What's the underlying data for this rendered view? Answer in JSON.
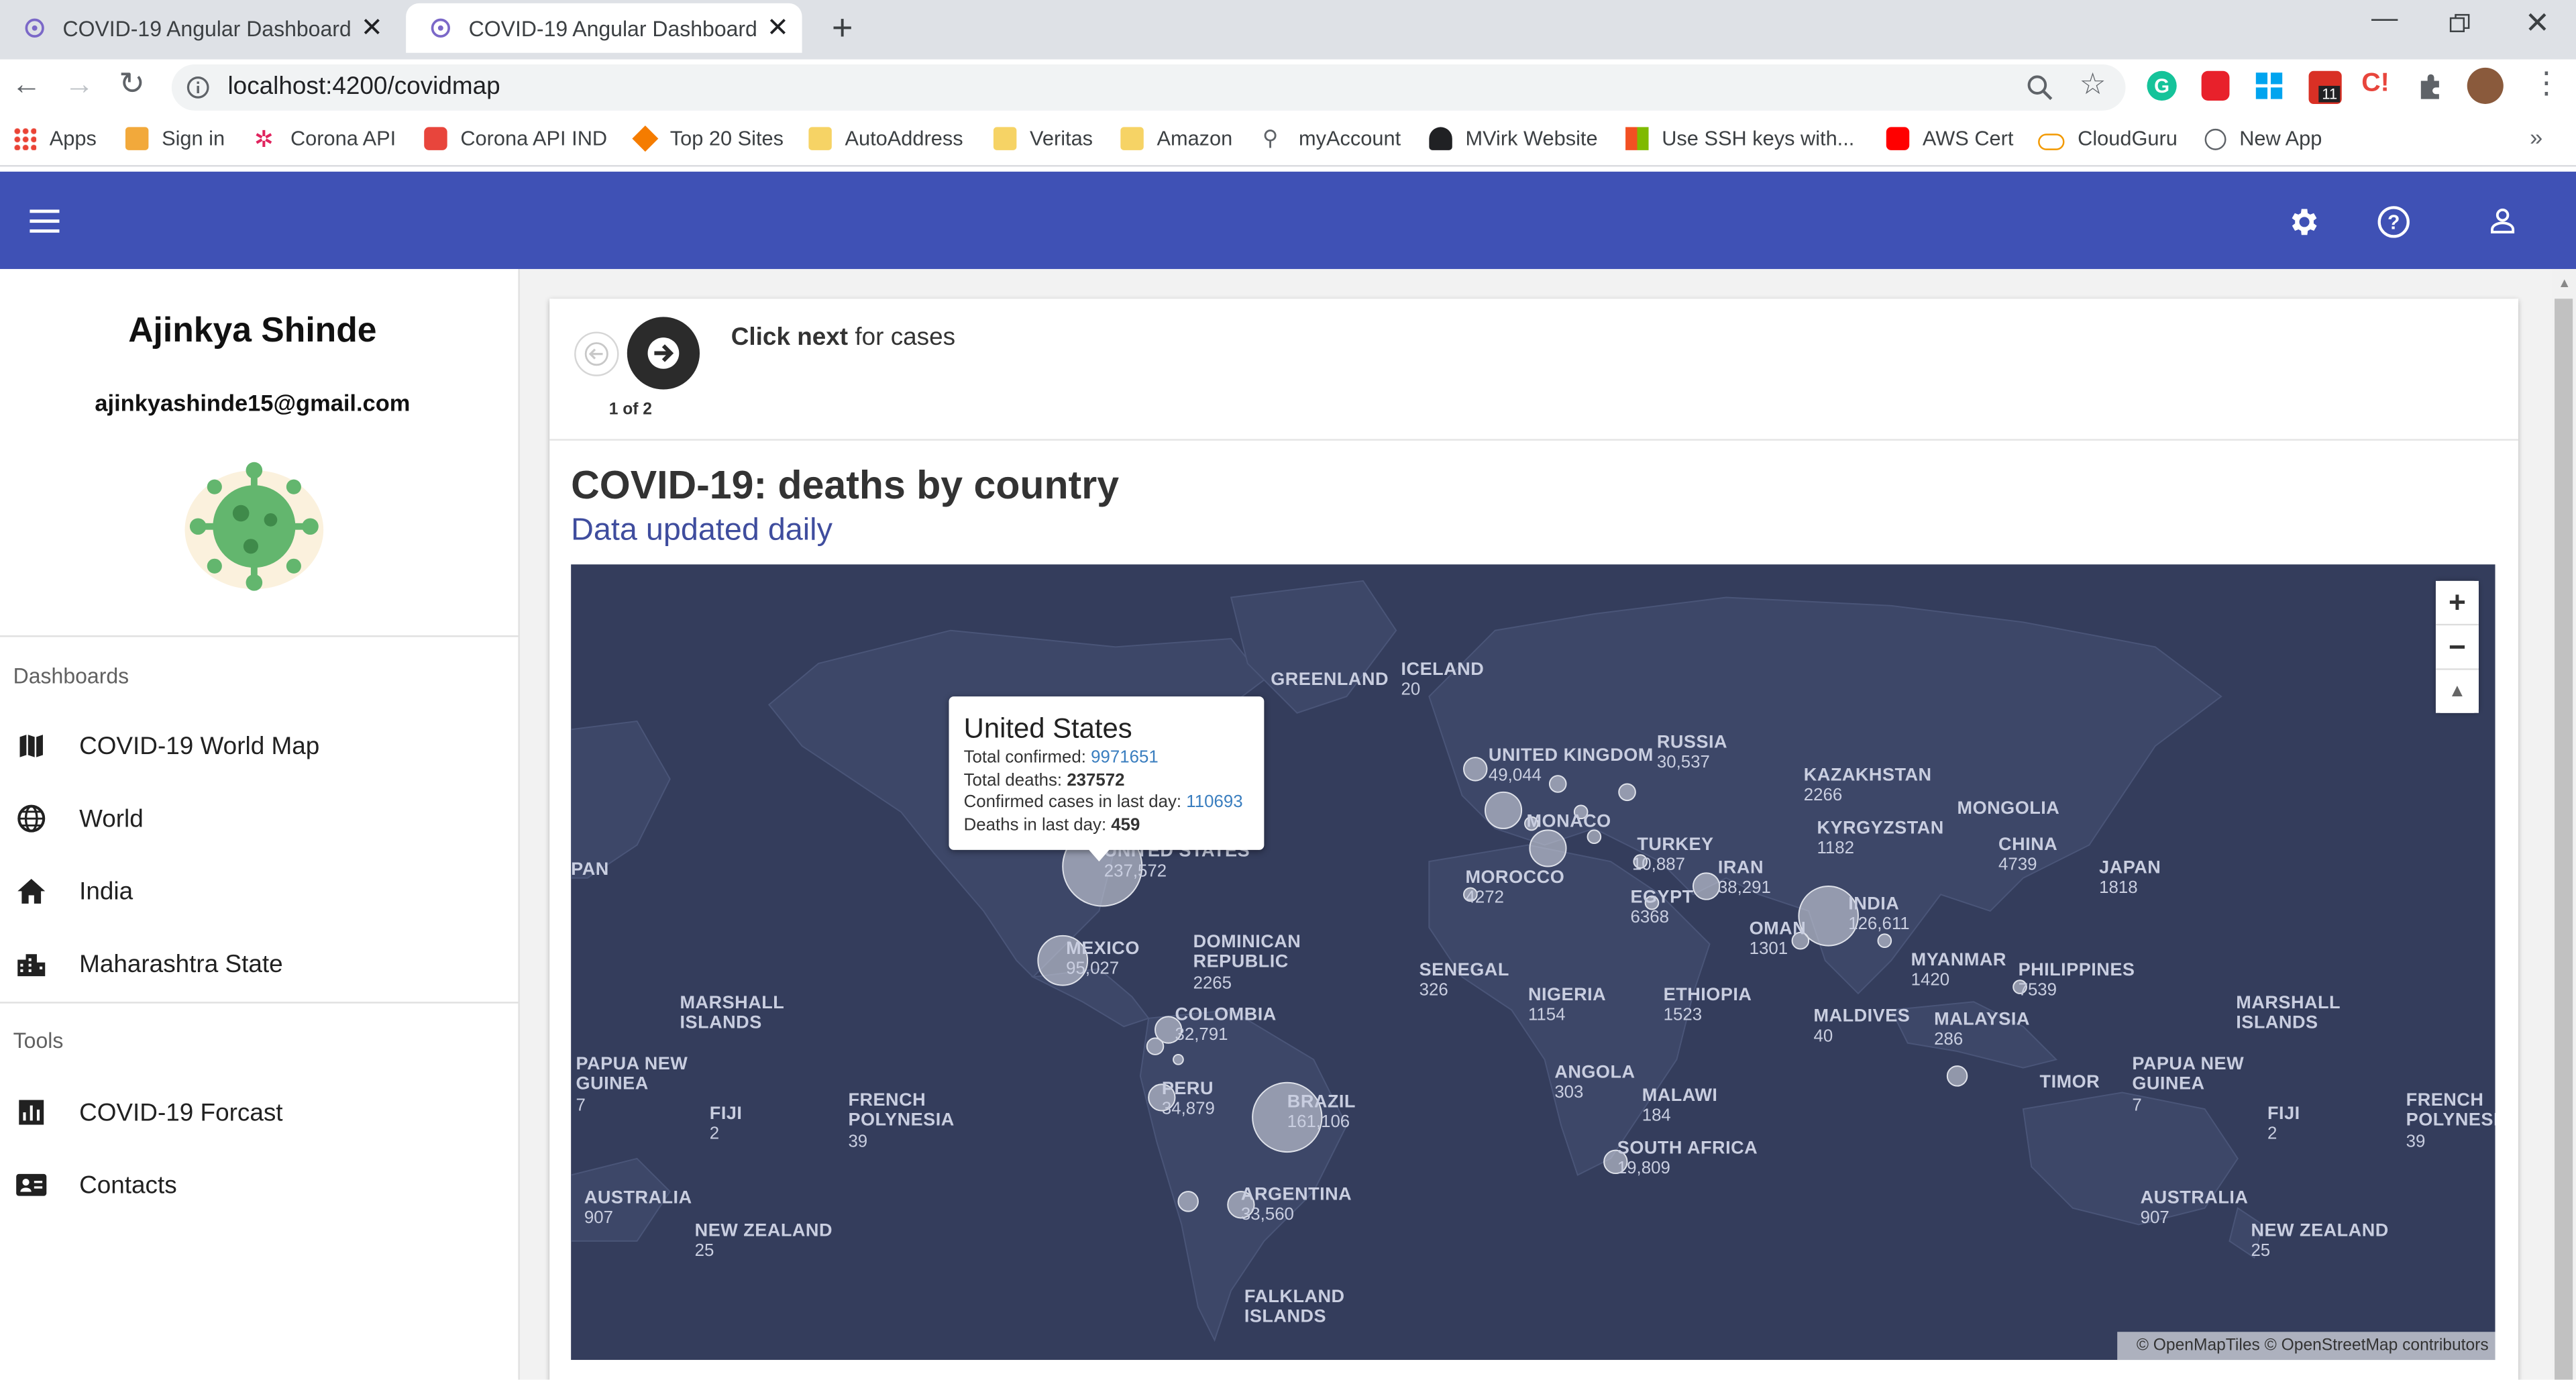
{
  "browser": {
    "tabs": [
      {
        "title": "COVID-19 Angular Dashboard"
      },
      {
        "title": "COVID-19 Angular Dashboard"
      }
    ],
    "url": "localhost:4200/covidmap",
    "bookmarks": [
      {
        "label": "Apps"
      },
      {
        "label": "Sign in"
      },
      {
        "label": "Corona API"
      },
      {
        "label": "Corona API IND"
      },
      {
        "label": "Top 20 Sites"
      },
      {
        "label": "AutoAddress"
      },
      {
        "label": "Veritas"
      },
      {
        "label": "Amazon"
      },
      {
        "label": "myAccount"
      },
      {
        "label": "MVirk Website"
      },
      {
        "label": "Use SSH keys with..."
      },
      {
        "label": "AWS Cert"
      },
      {
        "label": "CloudGuru"
      },
      {
        "label": "New App"
      }
    ],
    "more": "»",
    "calendar_badge": "11"
  },
  "sidebar": {
    "user_name": "Ajinkya Shinde",
    "user_email": "ajinkyashinde15@gmail.com",
    "dashboards_title": "Dashboards",
    "dashboards": [
      {
        "label": "COVID-19 World Map",
        "icon": "map-icon"
      },
      {
        "label": "World",
        "icon": "globe-icon"
      },
      {
        "label": "India",
        "icon": "home-icon"
      },
      {
        "label": "Maharashtra State",
        "icon": "city-icon"
      }
    ],
    "tools_title": "Tools",
    "tools": [
      {
        "label": "COVID-19 Forcast",
        "icon": "chart-icon"
      },
      {
        "label": "Contacts",
        "icon": "contact-card-icon"
      }
    ]
  },
  "stepper": {
    "bold": "Click next",
    "rest": " for cases",
    "page": "1 of 2"
  },
  "chart": {
    "title": "COVID-19: deaths by country",
    "subtitle": "Data updated daily"
  },
  "map_labels": [
    {
      "name": "GREENLAND",
      "value": ""
    },
    {
      "name": "ICELAND",
      "value": "20"
    },
    {
      "name": "UNITED KINGDOM",
      "value": "49,044"
    },
    {
      "name": "RUSSIA",
      "value": "30,537"
    },
    {
      "name": "KAZAKHSTAN",
      "value": "2266"
    },
    {
      "name": "MONGOLIA",
      "value": ""
    },
    {
      "name": "KYRGYZSTAN",
      "value": "1182"
    },
    {
      "name": "MONACO",
      "value": ""
    },
    {
      "name": "TURKEY",
      "value": "10,887"
    },
    {
      "name": "IRAN",
      "value": "38,291"
    },
    {
      "name": "CHINA",
      "value": "4739"
    },
    {
      "name": "JAPAN",
      "value": "1818"
    },
    {
      "name": "MOROCCO",
      "value": "4272"
    },
    {
      "name": "EGYPT",
      "value": "6368"
    },
    {
      "name": "INDIA",
      "value": "126,611"
    },
    {
      "name": "OMAN",
      "value": "1301"
    },
    {
      "name": "UNITED STATES",
      "value": "237,572"
    },
    {
      "name": "DOMINICAN REPUBLIC",
      "value": "2265"
    },
    {
      "name": "MEXICO",
      "value": "95,027"
    },
    {
      "name": "MYANMAR",
      "value": "1420"
    },
    {
      "name": "PHILIPPINES",
      "value": "7539"
    },
    {
      "name": "SENEGAL",
      "value": "326"
    },
    {
      "name": "NIGERIA",
      "value": "1154"
    },
    {
      "name": "ETHIOPIA",
      "value": "1523"
    },
    {
      "name": "MALDIVES",
      "value": "40"
    },
    {
      "name": "MALAYSIA",
      "value": "286"
    },
    {
      "name": "COLOMBIA",
      "value": "32,791"
    },
    {
      "name": "MARSHALL ISLANDS",
      "value": ""
    },
    {
      "name": "MARSHALL ISLANDS",
      "value": ""
    },
    {
      "name": "PAPUA NEW GUINEA",
      "value": "7"
    },
    {
      "name": "PAPUA NEW GUINEA",
      "value": "7"
    },
    {
      "name": "TIMOR",
      "value": ""
    },
    {
      "name": "FIJI",
      "value": "2"
    },
    {
      "name": "FIJI",
      "value": "2"
    },
    {
      "name": "FRENCH POLYNESIA",
      "value": "39"
    },
    {
      "name": "FRENCH POLYNESI",
      "value": "39"
    },
    {
      "name": "PERU",
      "value": "34,879"
    },
    {
      "name": "BRAZIL",
      "value": "161,106"
    },
    {
      "name": "ANGOLA",
      "value": "303"
    },
    {
      "name": "MALAWI",
      "value": "184"
    },
    {
      "name": "SOUTH AFRICA",
      "value": "19,809"
    },
    {
      "name": "AUSTRALIA",
      "value": "907"
    },
    {
      "name": "AUSTRALIA",
      "value": "907"
    },
    {
      "name": "NEW ZEALAND",
      "value": "25"
    },
    {
      "name": "NEW ZEALAND",
      "value": "25"
    },
    {
      "name": "ARGENTINA",
      "value": "33,560"
    },
    {
      "name": "FALKLAND ISLANDS",
      "value": ""
    },
    {
      "name": "PAN",
      "value": ""
    }
  ],
  "tooltip": {
    "country": "United States",
    "confirmed_label": "Total confirmed: ",
    "confirmed": "9971651",
    "deaths_label": "Total deaths: ",
    "deaths": "237572",
    "last_day_label": "Confirmed cases in last day: ",
    "last_day": "110693",
    "deaths_last_label": "Deaths in last day: ",
    "deaths_last": "459"
  },
  "map_controls": {
    "zoom_in": "+",
    "zoom_out": "−",
    "compass": "▲"
  },
  "attribution": "© OpenMapTiles © OpenStreetMap contributors",
  "colors": {
    "appbar": "#3f51b5",
    "map_bg": "#343d5c",
    "land": "#3d4768",
    "bubble": "#b5b9c8",
    "tooltip_link": "#3a7ebf"
  }
}
